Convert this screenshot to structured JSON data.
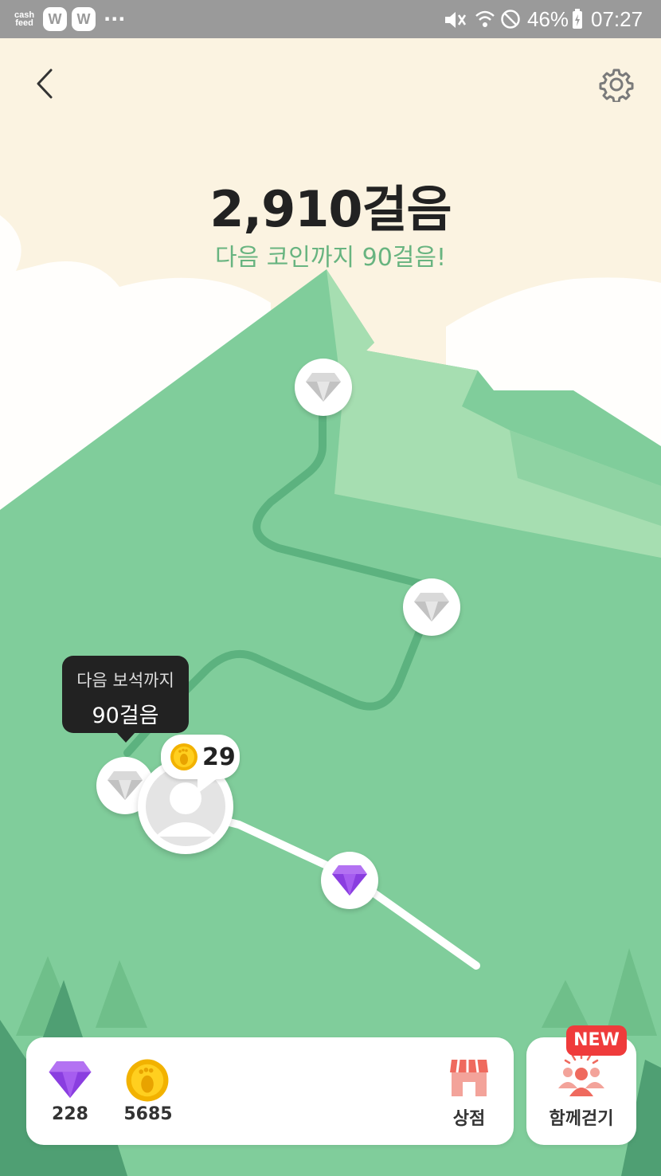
{
  "status_bar": {
    "app_logo_top": "cash",
    "app_logo_bottom": "feed",
    "notif1": "W",
    "notif2": "W",
    "more": "...",
    "battery": "46%",
    "time": "07:27"
  },
  "header": {
    "steps": "2,910걸음",
    "next_coin": "다음 코인까지 90걸음!"
  },
  "path": {
    "tooltip_line1": "다음 보석까지",
    "tooltip_line2": "90걸음",
    "coin_count": "29",
    "nodes": [
      "diamond-gray",
      "diamond-gray",
      "diamond-gray",
      "diamond-purple"
    ]
  },
  "bottom": {
    "gems": "228",
    "coins": "5685",
    "shop_label": "상점",
    "walk_together_label": "함께걷기",
    "new_badge": "NEW"
  },
  "colors": {
    "background": "#fbf3e1",
    "mountain": "#80cd9b",
    "path": "#5cb27f",
    "accent_text": "#68b480",
    "gem_purple": "#9b4de8",
    "new_badge": "#ef3b3b"
  }
}
